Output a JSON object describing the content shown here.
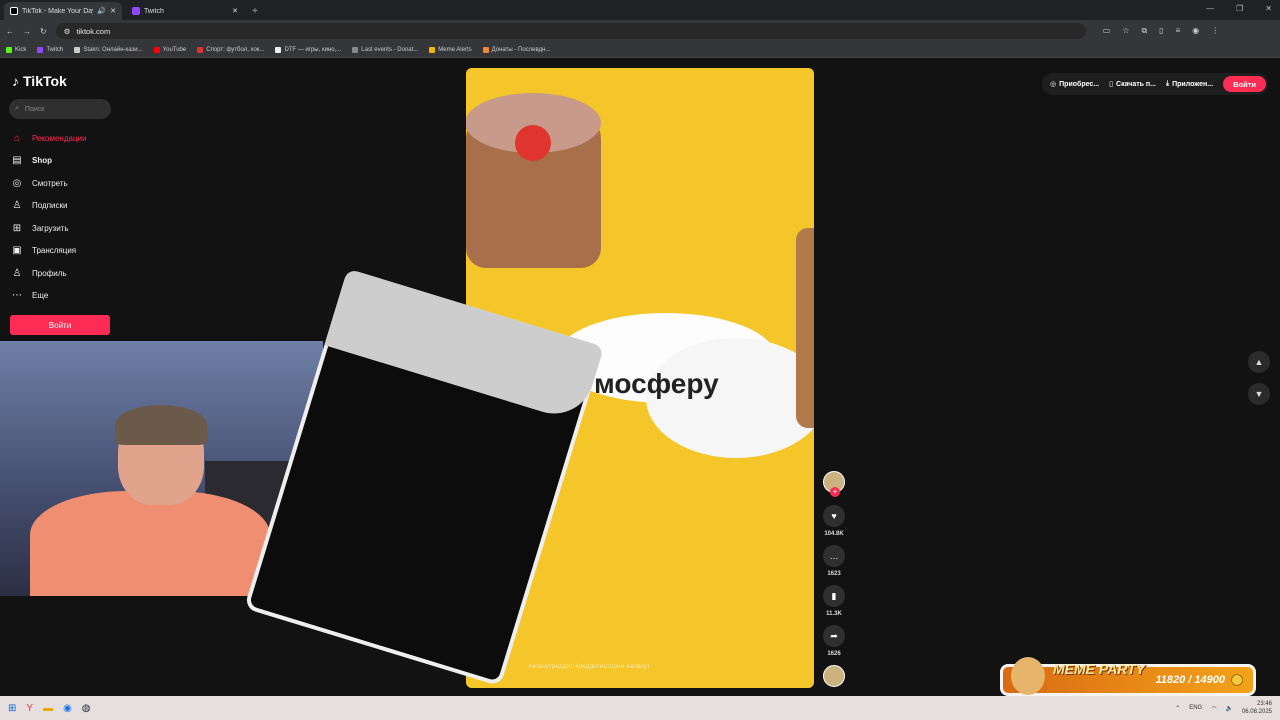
{
  "browser": {
    "tabs": [
      {
        "title": "TikTok - Make Your Day",
        "active": true,
        "color": "#111111"
      },
      {
        "title": "Twitch",
        "active": false,
        "color": "#9146ff"
      }
    ],
    "new_tab": "+",
    "url": "tiktok.com",
    "bookmarks": [
      {
        "label": "Kick",
        "color": "#53fc18"
      },
      {
        "label": "Twitch",
        "color": "#9146ff"
      },
      {
        "label": "Stakn: Онлайн-кази...",
        "color": "#cccccc"
      },
      {
        "label": "YouTube",
        "color": "#ff0000"
      },
      {
        "label": "Спорт: футбол, хок...",
        "color": "#e03030"
      },
      {
        "label": "DTF — игры, кино,...",
        "color": "#eeeeee"
      },
      {
        "label": "Last events - Donat...",
        "color": "#888888"
      },
      {
        "label": "Meme Alerts",
        "color": "#f2b600"
      },
      {
        "label": "Донаты - Послевдн...",
        "color": "#f08a24"
      }
    ]
  },
  "tiktok": {
    "logo": "TikTok",
    "search_placeholder": "Поиск",
    "nav": [
      {
        "label": "Рекомендации",
        "icon": "home-icon",
        "glyph": "⌂",
        "active": true
      },
      {
        "label": "Shop",
        "icon": "shop-icon",
        "glyph": "▤",
        "active": false
      },
      {
        "label": "Смотреть",
        "icon": "compass-icon",
        "glyph": "◎",
        "active": false
      },
      {
        "label": "Подписки",
        "icon": "following-icon",
        "glyph": "♙",
        "active": false
      },
      {
        "label": "Загрузить",
        "icon": "upload-icon",
        "glyph": "⊞",
        "active": false
      },
      {
        "label": "Трансляция",
        "icon": "live-icon",
        "glyph": "▣",
        "active": false
      },
      {
        "label": "Профиль",
        "icon": "profile-icon",
        "glyph": "♙",
        "active": false
      },
      {
        "label": "Еще",
        "icon": "more-icon",
        "glyph": "⋯",
        "active": false
      }
    ],
    "login_label": "Войти",
    "top_bar": {
      "buy": "Приобрес...",
      "download": "Скачать п...",
      "apps": "Приложен...",
      "login": "Войти"
    },
    "video": {
      "caption": "мосферу",
      "hashtags": "#апвоутреддит  #реддитистории  #апвоут"
    },
    "actions": {
      "likes": "104.8K",
      "comments": "1623",
      "saves": "11.3K",
      "shares": "1626"
    },
    "accent": "#fe2c55"
  },
  "overlay": {
    "meme_title": "MEME PARTY",
    "meme_progress": "11820 / 14900"
  },
  "taskbar": {
    "lang": "ENG",
    "time": "23:46",
    "date": "06.08.2025"
  }
}
